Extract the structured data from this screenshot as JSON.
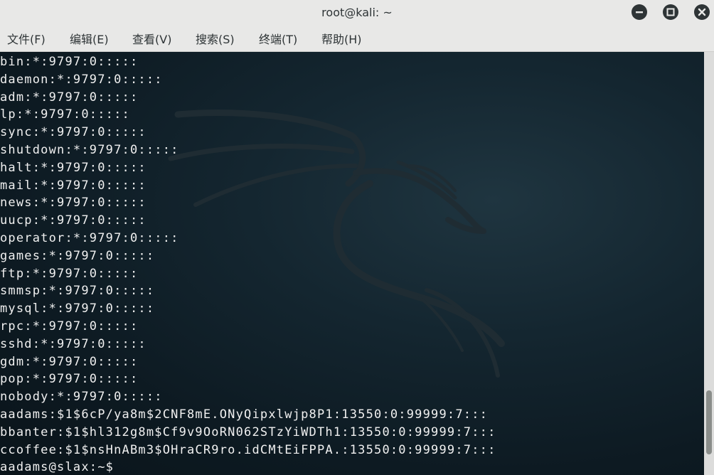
{
  "window": {
    "title": "root@kali: ~"
  },
  "menu": {
    "items": [
      {
        "label": "文件(F)"
      },
      {
        "label": "编辑(E)"
      },
      {
        "label": "查看(V)"
      },
      {
        "label": "搜索(S)"
      },
      {
        "label": "终端(T)"
      },
      {
        "label": "帮助(H)"
      }
    ]
  },
  "terminal": {
    "lines": [
      "bin:*:9797:0:::::",
      "daemon:*:9797:0:::::",
      "adm:*:9797:0:::::",
      "lp:*:9797:0:::::",
      "sync:*:9797:0:::::",
      "shutdown:*:9797:0:::::",
      "halt:*:9797:0:::::",
      "mail:*:9797:0:::::",
      "news:*:9797:0:::::",
      "uucp:*:9797:0:::::",
      "operator:*:9797:0:::::",
      "games:*:9797:0:::::",
      "ftp:*:9797:0:::::",
      "smmsp:*:9797:0:::::",
      "mysql:*:9797:0:::::",
      "rpc:*:9797:0:::::",
      "sshd:*:9797:0:::::",
      "gdm:*:9797:0:::::",
      "pop:*:9797:0:::::",
      "nobody:*:9797:0:::::",
      "aadams:$1$6cP/ya8m$2CNF8mE.ONyQipxlwjp8P1:13550:0:99999:7:::",
      "bbanter:$1$hl312g8m$Cf9v9OoRN062STzYiWDTh1:13550:0:99999:7:::",
      "ccoffee:$1$nsHnABm3$OHraCR9ro.idCMtEiFPPA.:13550:0:99999:7:::",
      "aadams@slax:~$"
    ]
  },
  "colors": {
    "titlebar": "#e8e8e7",
    "terminal_bg": "#0d1a22",
    "terminal_fg": "#f0f0f0",
    "dragon": "#1e2a30"
  },
  "scroll": {
    "position": 0.95
  }
}
